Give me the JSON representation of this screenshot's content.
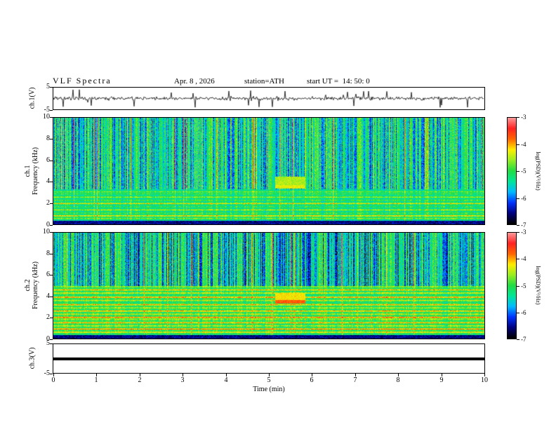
{
  "header": {
    "title": "VLF Spectra",
    "date": "Apr. 8 , 2026",
    "station": "station=ATH",
    "start_ut": "start UT =  14: 50: 0"
  },
  "axes": {
    "x": {
      "label": "Time (min)",
      "ticks": [
        "0",
        "1",
        "2",
        "3",
        "4",
        "5",
        "6",
        "7",
        "8",
        "9",
        "10"
      ]
    }
  },
  "panels": {
    "wave1": {
      "ylabel": "ch.1(V)",
      "yticks": [
        "5",
        "-5"
      ]
    },
    "spec1": {
      "ylabel_line1": "ch.1",
      "ylabel_line2": "Frequency (kHz)",
      "yticks": [
        "0",
        "2",
        "4",
        "6",
        "8",
        "10"
      ]
    },
    "spec2": {
      "ylabel_line1": "ch.2",
      "ylabel_line2": "Frequency (kHz)",
      "yticks": [
        "0",
        "2",
        "4",
        "6",
        "8",
        "10"
      ]
    },
    "wave3": {
      "ylabel": "ch.3(V)",
      "yticks": [
        "5",
        "-5"
      ]
    }
  },
  "colorbar": {
    "label": "log(PSD)(V²/Hz)",
    "ticks": [
      "-3",
      "-4",
      "-5",
      "-6",
      "-7"
    ]
  },
  "chart_data": {
    "type": "heatmap",
    "title": "VLF Spectra",
    "subtitle": "Apr. 8 , 2026  station=ATH  start UT = 14:50:0",
    "x": {
      "label": "Time (min)",
      "range": [
        0,
        10
      ],
      "unit": "min"
    },
    "colormap": [
      "#000000",
      "#000080",
      "#0033ff",
      "#00bbff",
      "#00e699",
      "#22dd44",
      "#99ee22",
      "#ffee00",
      "#ff6600",
      "#ff2222",
      "#ff9999"
    ],
    "colorbar": {
      "label": "log(PSD)(V^2/Hz)",
      "range": [
        -7,
        -3
      ],
      "ticks": [
        -3,
        -4,
        -5,
        -6,
        -7
      ]
    },
    "panels": [
      {
        "id": "ch1_waveform",
        "type": "line",
        "ylabel": "ch.1(V)",
        "yrange": [
          -5,
          5
        ],
        "character": "continuous broadband noise of ~±1 V with impulsive sferic spikes reaching ±4 V"
      },
      {
        "id": "ch1_spectrogram",
        "type": "spectrogram",
        "ylabel": "ch.1 Frequency (kHz)",
        "yrange_khz": [
          0,
          10
        ],
        "dark_band_khz": [
          0,
          0.35
        ],
        "band_region_top_khz": 3.3,
        "harmonic_bands": [
          [
            0.55,
            0.18
          ],
          [
            0.8,
            0.3
          ],
          [
            1.05,
            0.12
          ],
          [
            1.35,
            0.22
          ],
          [
            1.65,
            0.1
          ],
          [
            1.95,
            0.28
          ],
          [
            2.25,
            0.12
          ],
          [
            2.55,
            0.2
          ],
          [
            2.85,
            0.1
          ],
          [
            3.05,
            0.15
          ]
        ],
        "transmitter_block": {
          "t_min": [
            5.15,
            5.85
          ],
          "f_khz": [
            3.35,
            4.5
          ]
        },
        "texture": "dense blue vertical striations above 3.3 kHz on a green background with occasional yellow-orange vertical lines; colored horizontal harmonic bands below 3.3 kHz; near-black band below 0.35 kHz"
      },
      {
        "id": "ch2_spectrogram",
        "type": "spectrogram",
        "ylabel": "ch.2 Frequency (kHz)",
        "yrange_khz": [
          0,
          10
        ],
        "dark_band_khz": [
          0,
          0.35
        ],
        "band_region_top_khz": 5.0,
        "harmonic_bands": [
          [
            0.6,
            0.25
          ],
          [
            0.9,
            0.35
          ],
          [
            1.2,
            0.2
          ],
          [
            1.5,
            0.3
          ],
          [
            1.8,
            0.15
          ],
          [
            2.0,
            0.38
          ],
          [
            2.3,
            0.2
          ],
          [
            2.6,
            0.3
          ],
          [
            2.9,
            0.18
          ],
          [
            3.2,
            0.3
          ],
          [
            3.6,
            0.2
          ],
          [
            3.9,
            0.34
          ],
          [
            4.3,
            0.22
          ],
          [
            4.6,
            0.28
          ],
          [
            4.9,
            0.15
          ]
        ],
        "transmitter_block": {
          "t_min": [
            5.15,
            5.85
          ],
          "f_khz": [
            3.3,
            4.3
          ]
        },
        "texture": "deep blue vertical striations above 5 kHz; strong colored horizontal harmonic bands below 5 kHz; near-black band below 0.35 kHz"
      },
      {
        "id": "ch3_waveform",
        "type": "line",
        "ylabel": "ch.3(V)",
        "yrange": [
          -5,
          5
        ],
        "character": "flat thick line at 0 V (no signal)"
      }
    ]
  }
}
